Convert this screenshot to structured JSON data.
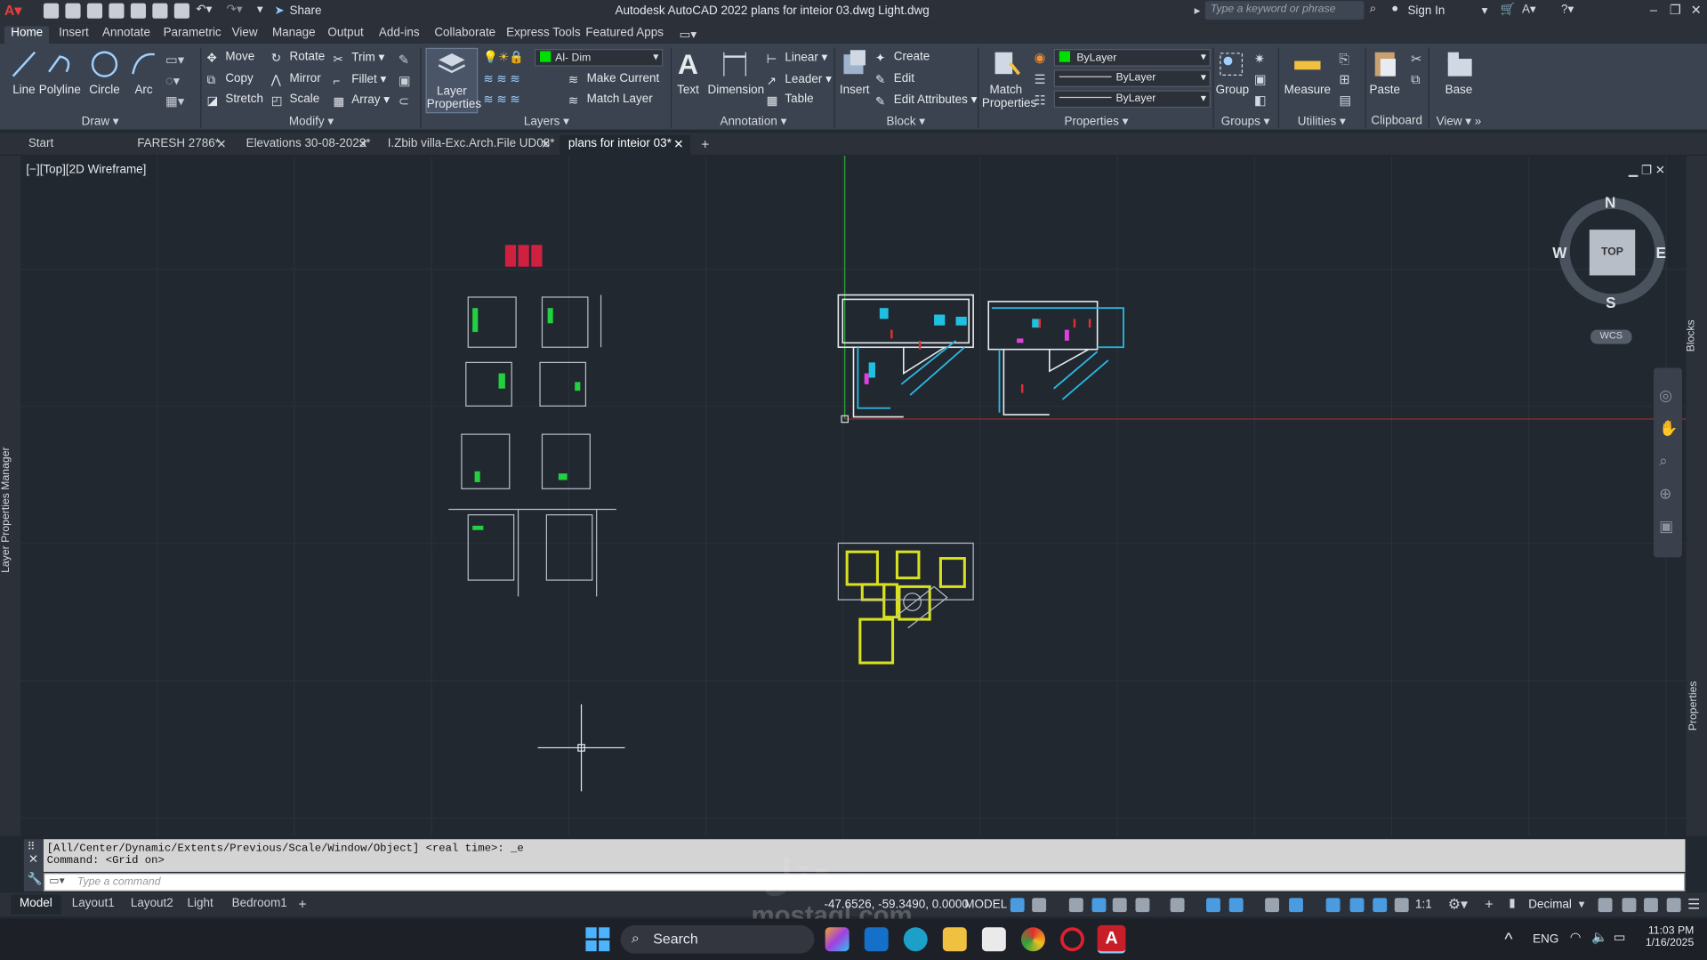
{
  "titlebar": {
    "title": "Autodesk AutoCAD 2022   plans for inteior 03.dwg Light.dwg",
    "share": "Share",
    "search_placeholder": "Type a keyword or phrase",
    "sign_in": "Sign In"
  },
  "ribbon_tabs": [
    "Home",
    "Insert",
    "Annotate",
    "Parametric",
    "View",
    "Manage",
    "Output",
    "Add-ins",
    "Collaborate",
    "Express Tools",
    "Featured Apps"
  ],
  "active_ribbon_tab": "Home",
  "draw": {
    "title": "Draw",
    "line": "Line",
    "polyline": "Polyline",
    "circle": "Circle",
    "arc": "Arc"
  },
  "modify": {
    "title": "Modify",
    "move": "Move",
    "rotate": "Rotate",
    "trim": "Trim",
    "copy": "Copy",
    "mirror": "Mirror",
    "fillet": "Fillet",
    "stretch": "Stretch",
    "scale": "Scale",
    "array": "Array"
  },
  "layers": {
    "title": "Layers",
    "layer_properties_1": "Layer",
    "layer_properties_2": "Properties",
    "current_layer": "Al- Dim",
    "make_current": "Make Current",
    "match_layer": "Match Layer"
  },
  "annotation": {
    "title": "Annotation",
    "text": "Text",
    "dimension": "Dimension",
    "linear": "Linear",
    "leader": "Leader",
    "table": "Table"
  },
  "block": {
    "title": "Block",
    "insert": "Insert",
    "create": "Create",
    "edit": "Edit",
    "edit_attributes": "Edit Attributes"
  },
  "properties": {
    "title": "Properties",
    "match_1": "Match",
    "match_2": "Properties",
    "color": "ByLayer",
    "linetype": "ByLayer",
    "lineweight": "ByLayer"
  },
  "groups": {
    "title": "Groups",
    "group": "Group"
  },
  "utilities": {
    "title": "Utilities",
    "measure": "Measure"
  },
  "clipboard": {
    "title": "Clipboard",
    "paste": "Paste"
  },
  "view": {
    "title": "View",
    "base": "Base"
  },
  "doc_tabs": [
    "Start",
    "FARESH 2786*",
    "Elevations 30-08-2023*",
    "I.Zbib villa-Exc.Arch.File UD08*",
    "plans for inteior 03*"
  ],
  "active_doc_tab": "plans for inteior 03*",
  "viewport": {
    "label": "[−][Top][2D Wireframe]",
    "compass_n": "N",
    "compass_s": "S",
    "compass_e": "E",
    "compass_w": "W",
    "cube_face": "TOP",
    "wcs": "WCS"
  },
  "side": {
    "left": "Layer Properties Manager",
    "right_top": "Blocks",
    "right_bottom": "Properties"
  },
  "command": {
    "line1": "[All/Center/Dynamic/Extents/Previous/Scale/Window/Object] <real time>: _e",
    "line2": "Command:  <Grid on>",
    "placeholder": "Type a command"
  },
  "layout_tabs": [
    "Model",
    "Layout1",
    "Layout2",
    "Light",
    "Bedroom1"
  ],
  "active_layout": "Model",
  "status": {
    "coords": "-47.6526, -59.3490, 0.0000",
    "model": "MODEL",
    "scale": "1:1",
    "units": "Decimal"
  },
  "taskbar": {
    "search": "Search",
    "lang": "ENG",
    "time": "11:03 PM",
    "date": "1/16/2025"
  },
  "watermark": {
    "top": "مستقل",
    "bottom": "mostaql.com"
  }
}
